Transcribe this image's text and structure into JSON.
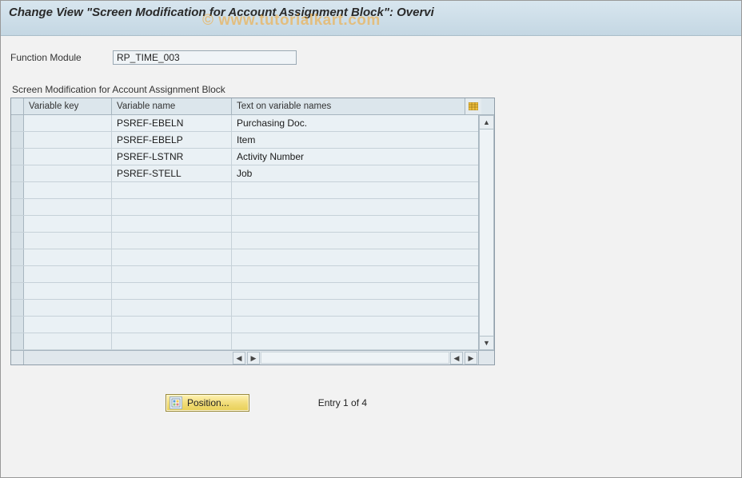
{
  "watermark": "© www.tutorialkart.com",
  "title": "Change View \"Screen Modification for Account Assignment Block\": Overvi",
  "fields": {
    "function_module": {
      "label": "Function Module",
      "value": "RP_TIME_003"
    }
  },
  "table": {
    "title": "Screen Modification for Account Assignment Block",
    "columns": {
      "variable_key": "Variable key",
      "variable_name": "Variable name",
      "text_on_variable_names": "Text on variable names"
    },
    "rows": [
      {
        "key": "",
        "name": "PSREF-EBELN",
        "text": "Purchasing Doc."
      },
      {
        "key": "",
        "name": "PSREF-EBELP",
        "text": "Item"
      },
      {
        "key": "",
        "name": "PSREF-LSTNR",
        "text": "Activity Number"
      },
      {
        "key": "",
        "name": "PSREF-STELL",
        "text": "Job"
      },
      {
        "key": "",
        "name": "",
        "text": ""
      },
      {
        "key": "",
        "name": "",
        "text": ""
      },
      {
        "key": "",
        "name": "",
        "text": ""
      },
      {
        "key": "",
        "name": "",
        "text": ""
      },
      {
        "key": "",
        "name": "",
        "text": ""
      },
      {
        "key": "",
        "name": "",
        "text": ""
      },
      {
        "key": "",
        "name": "",
        "text": ""
      },
      {
        "key": "",
        "name": "",
        "text": ""
      },
      {
        "key": "",
        "name": "",
        "text": ""
      },
      {
        "key": "",
        "name": "",
        "text": ""
      }
    ]
  },
  "footer": {
    "position_label": "Position...",
    "entry_text": "Entry 1 of 4"
  }
}
